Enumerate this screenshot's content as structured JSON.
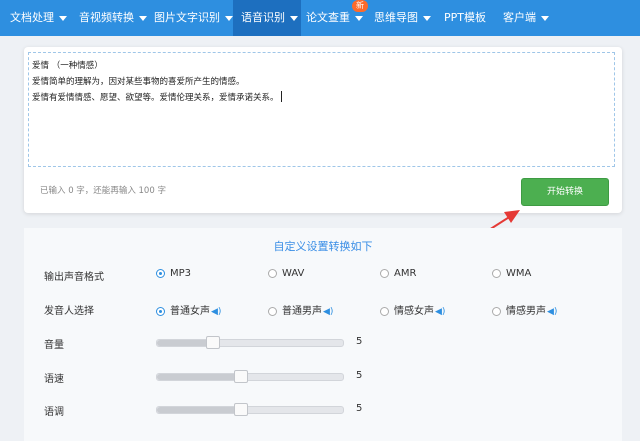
{
  "nav": {
    "items": [
      {
        "label": "文档处理",
        "has_caret": true
      },
      {
        "label": "音视频转换",
        "has_caret": true
      },
      {
        "label": "图片文字识别",
        "has_caret": true
      },
      {
        "label": "语音识别",
        "has_caret": true,
        "active": true
      },
      {
        "label": "论文查重",
        "has_caret": true
      },
      {
        "label": "思维导图",
        "has_caret": true
      },
      {
        "label": "PPT模板",
        "has_caret": false
      },
      {
        "label": "客户端",
        "has_caret": true
      }
    ],
    "new_badge": "新"
  },
  "editor": {
    "lines": [
      "爱情 （一种情感）",
      "爱情简单的理解为，因对某些事物的喜爱所产生的情感。",
      "爱情有爱情情感、愿望、欲望等。爱情伦理关系，爱情承诺关系。"
    ],
    "counter": "已输入 0 字，还能再输入 100 字",
    "convert_label": "开始转换"
  },
  "settings": {
    "title": "自定义设置转换如下",
    "format": {
      "label": "输出声音格式",
      "options": [
        "MP3",
        "WAV",
        "AMR",
        "WMA"
      ],
      "selected": "MP3"
    },
    "voice": {
      "label": "发音人选择",
      "options": [
        "普通女声",
        "普通男声",
        "情感女声",
        "情感男声"
      ],
      "selected": "普通女声"
    },
    "volume": {
      "label": "音量",
      "value": "5",
      "level": 0.3
    },
    "speed": {
      "label": "语速",
      "value": "5",
      "level": 0.45
    },
    "pitch": {
      "label": "语调",
      "value": "5",
      "level": 0.45
    }
  },
  "colors": {
    "nav_bg": "#2e8fe0",
    "button": "#4caf50",
    "accent": "#3a8ee6",
    "arrow": "#e53935"
  }
}
